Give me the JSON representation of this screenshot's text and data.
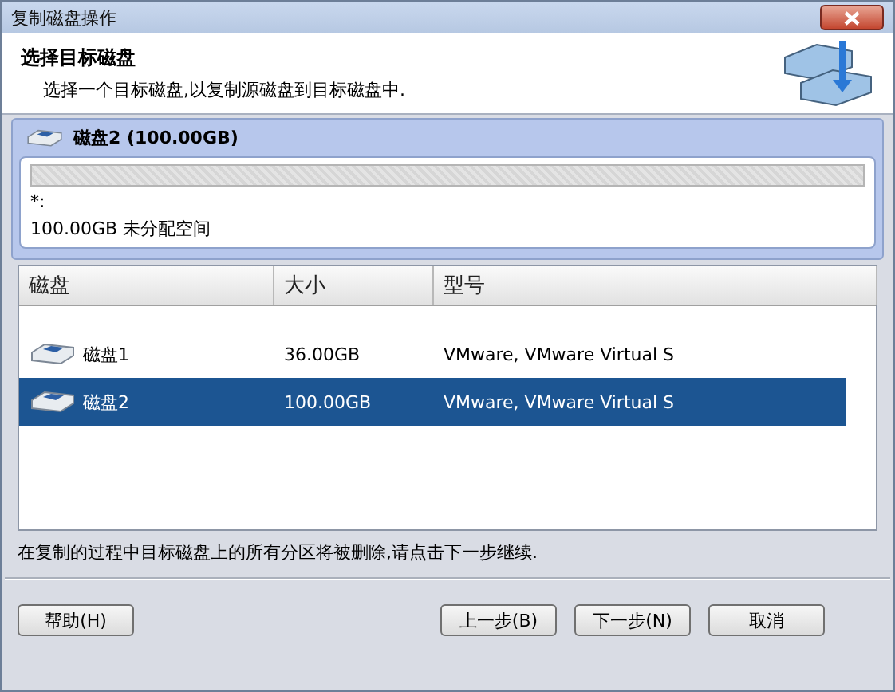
{
  "window": {
    "title": "复制磁盘操作"
  },
  "header": {
    "title": "选择目标磁盘",
    "subtitle": "选择一个目标磁盘,以复制源磁盘到目标磁盘中."
  },
  "preview": {
    "disk_title": "磁盘2 (100.00GB)",
    "partition_letter": "*:",
    "partition_text": "100.00GB 未分配空间"
  },
  "table": {
    "columns": [
      "磁盘",
      "大小",
      "型号"
    ],
    "rows": [
      {
        "name": "磁盘1",
        "size": "36.00GB",
        "model": "VMware, VMware Virtual S",
        "selected": false
      },
      {
        "name": "磁盘2",
        "size": "100.00GB",
        "model": "VMware, VMware Virtual S",
        "selected": true
      }
    ]
  },
  "note": "在复制的过程中目标磁盘上的所有分区将被删除,请点击下一步继续.",
  "buttons": [
    {
      "label": "帮助(H)",
      "kind": "left"
    },
    {
      "label": "上一步(B)",
      "kind": "right"
    },
    {
      "label": "下一步(N)",
      "kind": "right"
    },
    {
      "label": "取消",
      "kind": "right"
    }
  ]
}
